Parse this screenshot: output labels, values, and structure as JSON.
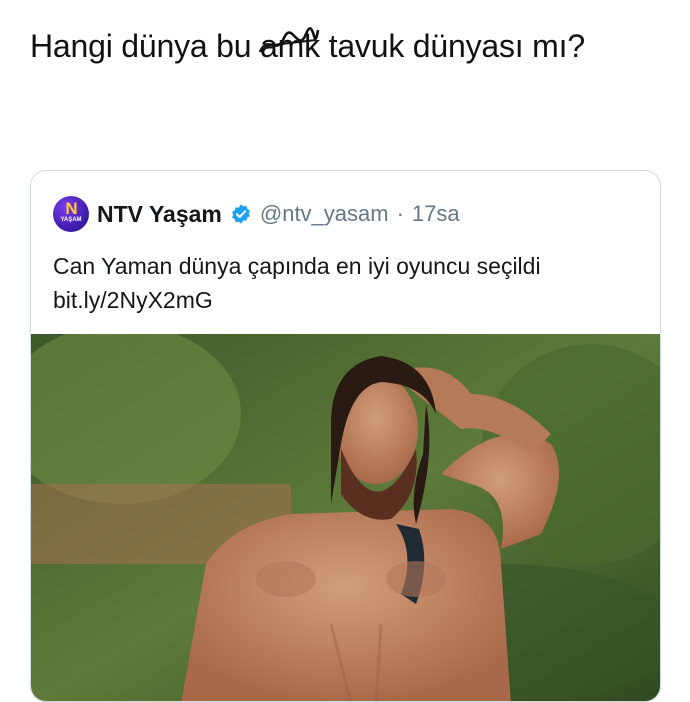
{
  "post": {
    "text_before": "Hangi dünya bu ",
    "scribbled_word": "amk",
    "text_after": " tavuk dünyası mı?"
  },
  "quoted_tweet": {
    "avatar_letter": "N",
    "avatar_sub": "YAŞAM",
    "display_name": "NTV Yaşam",
    "handle": "@ntv_yasam",
    "separator": "·",
    "time": "17sa",
    "text": "Can Yaman dünya çapında en iyi oyuncu seçildi bit.ly/2NyX2mG"
  },
  "colors": {
    "verified": "#1da1f2",
    "muted": "#657786",
    "border": "#cfd9de"
  },
  "icons": [
    "verified-badge-icon"
  ]
}
